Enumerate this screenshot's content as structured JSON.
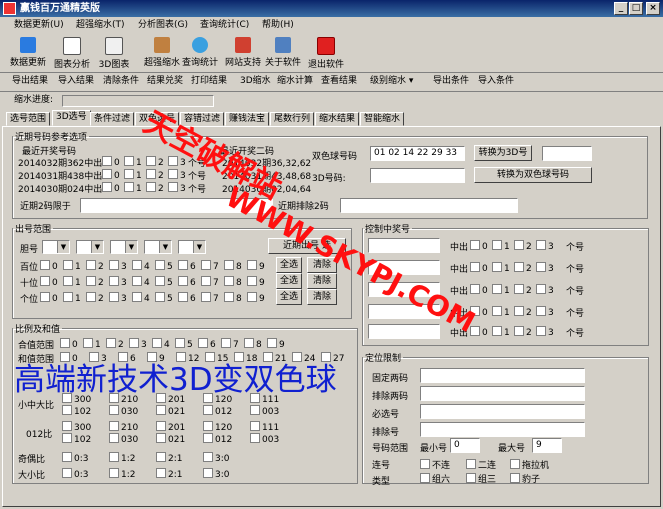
{
  "window": {
    "title": "赢钱百万通精英版",
    "min": "_",
    "max": "□",
    "close": "×"
  },
  "menu": [
    "数据更新(U)",
    "超强缩水(T)",
    "分析图表(G)",
    "查询统计(C)",
    "帮助(H)"
  ],
  "toolbar": [
    "数据更新",
    "图表分析",
    "3D图表",
    "超强缩水",
    "查询统计",
    "网站支持",
    "关于软件",
    "退出软件"
  ],
  "cmdbar": [
    "导出结果",
    "导入结果",
    "清除条件",
    "结果兑奖",
    "打印结果",
    "3D缩水",
    "缩水计算",
    "查看结果",
    "级别缩水 ▾",
    "导出条件",
    "导入条件"
  ],
  "progress": {
    "label": "缩水进度:",
    "value": 0
  },
  "tabs": [
    "选号范围",
    "3D选号",
    "条件过滤",
    "双色选号",
    "容错过滤",
    "赚钱法宝",
    "尾数行列",
    "缩水结果",
    "智能缩水"
  ],
  "recent": {
    "legend": "近期号码参考选项",
    "col1_title": "最近开奖号码",
    "col2_title": "最近开奖二码",
    "rows": [
      "2014032期362中出",
      "2014031期438中出",
      "2014030期024中出"
    ],
    "right_rows": [
      "2014032期36,32,62",
      "2014031期43,48,68",
      "2014030期02,04,64"
    ],
    "count_label": "个号",
    "limit_label": "近期2码限于",
    "exclude_label": "近期排除2码",
    "ssq_label": "双色球号码",
    "ssq_value": "01 02 14 22 29 33",
    "to3d_btn": "转换为3D号",
    "d3_label": "3D号码:",
    "tossq_btn": "转换为双色球号码"
  },
  "digits": [
    "0",
    "1",
    "2",
    "3",
    "4",
    "5",
    "6",
    "7",
    "8",
    "9"
  ],
  "chuhao": {
    "legend": "出号范围",
    "dan_label": "胆号",
    "recent_btn": "近期出号",
    "recent_btn_tail": "选",
    "rows": [
      "百位",
      "十位",
      "个位"
    ],
    "select_all": "全选",
    "clear": "清除"
  },
  "control": {
    "legend": "控制中奖号",
    "out": "中出",
    "count": "个号",
    "nums": [
      "0",
      "1",
      "2",
      "3"
    ]
  },
  "ratio": {
    "legend": "比例及和值",
    "hezhi_label": "合值范围",
    "hezhi_range_label": "和值范围",
    "hezhi_nums": [
      "0",
      "1",
      "2",
      "3",
      "4",
      "5",
      "6",
      "7",
      "8",
      "9"
    ],
    "sum_nums": [
      "0",
      "3",
      "6",
      "9",
      "12",
      "15",
      "18",
      "21",
      "24",
      "27"
    ],
    "big_small_label": "小中大比",
    "r012_label": "012比",
    "row_a": [
      "300",
      "210",
      "201",
      "120",
      "111"
    ],
    "row_b": [
      "102",
      "030",
      "021",
      "012",
      "003"
    ],
    "odd_even_label": "奇偶比",
    "big_small2_label": "大小比",
    "ratio_vals": [
      "0:3",
      "1:2",
      "2:1",
      "3:0"
    ]
  },
  "position": {
    "legend": "定位限制",
    "labels": [
      "排除两码",
      "必选号",
      "排除号"
    ],
    "first_label": "固定两码",
    "range_label": "号码范围",
    "min_label": "最小号",
    "min_value": "0",
    "max_label": "最大号",
    "max_value": "9",
    "lian_label": "连号",
    "lian_opts": [
      "不连",
      "二连",
      "拖拉机"
    ],
    "type_label": "类型",
    "type_opts": [
      "组六",
      "组三",
      "豹子"
    ]
  },
  "watermarks": {
    "w1": "天空破解站",
    "w2": "WWW.SKYPJ.COM",
    "slogan": "高端新技术3D变双色球"
  },
  "colors": {
    "title_start": "#0a246a",
    "title_end": "#3a6ea5",
    "watermark": "#ff1010",
    "slogan": "#1020d0"
  }
}
